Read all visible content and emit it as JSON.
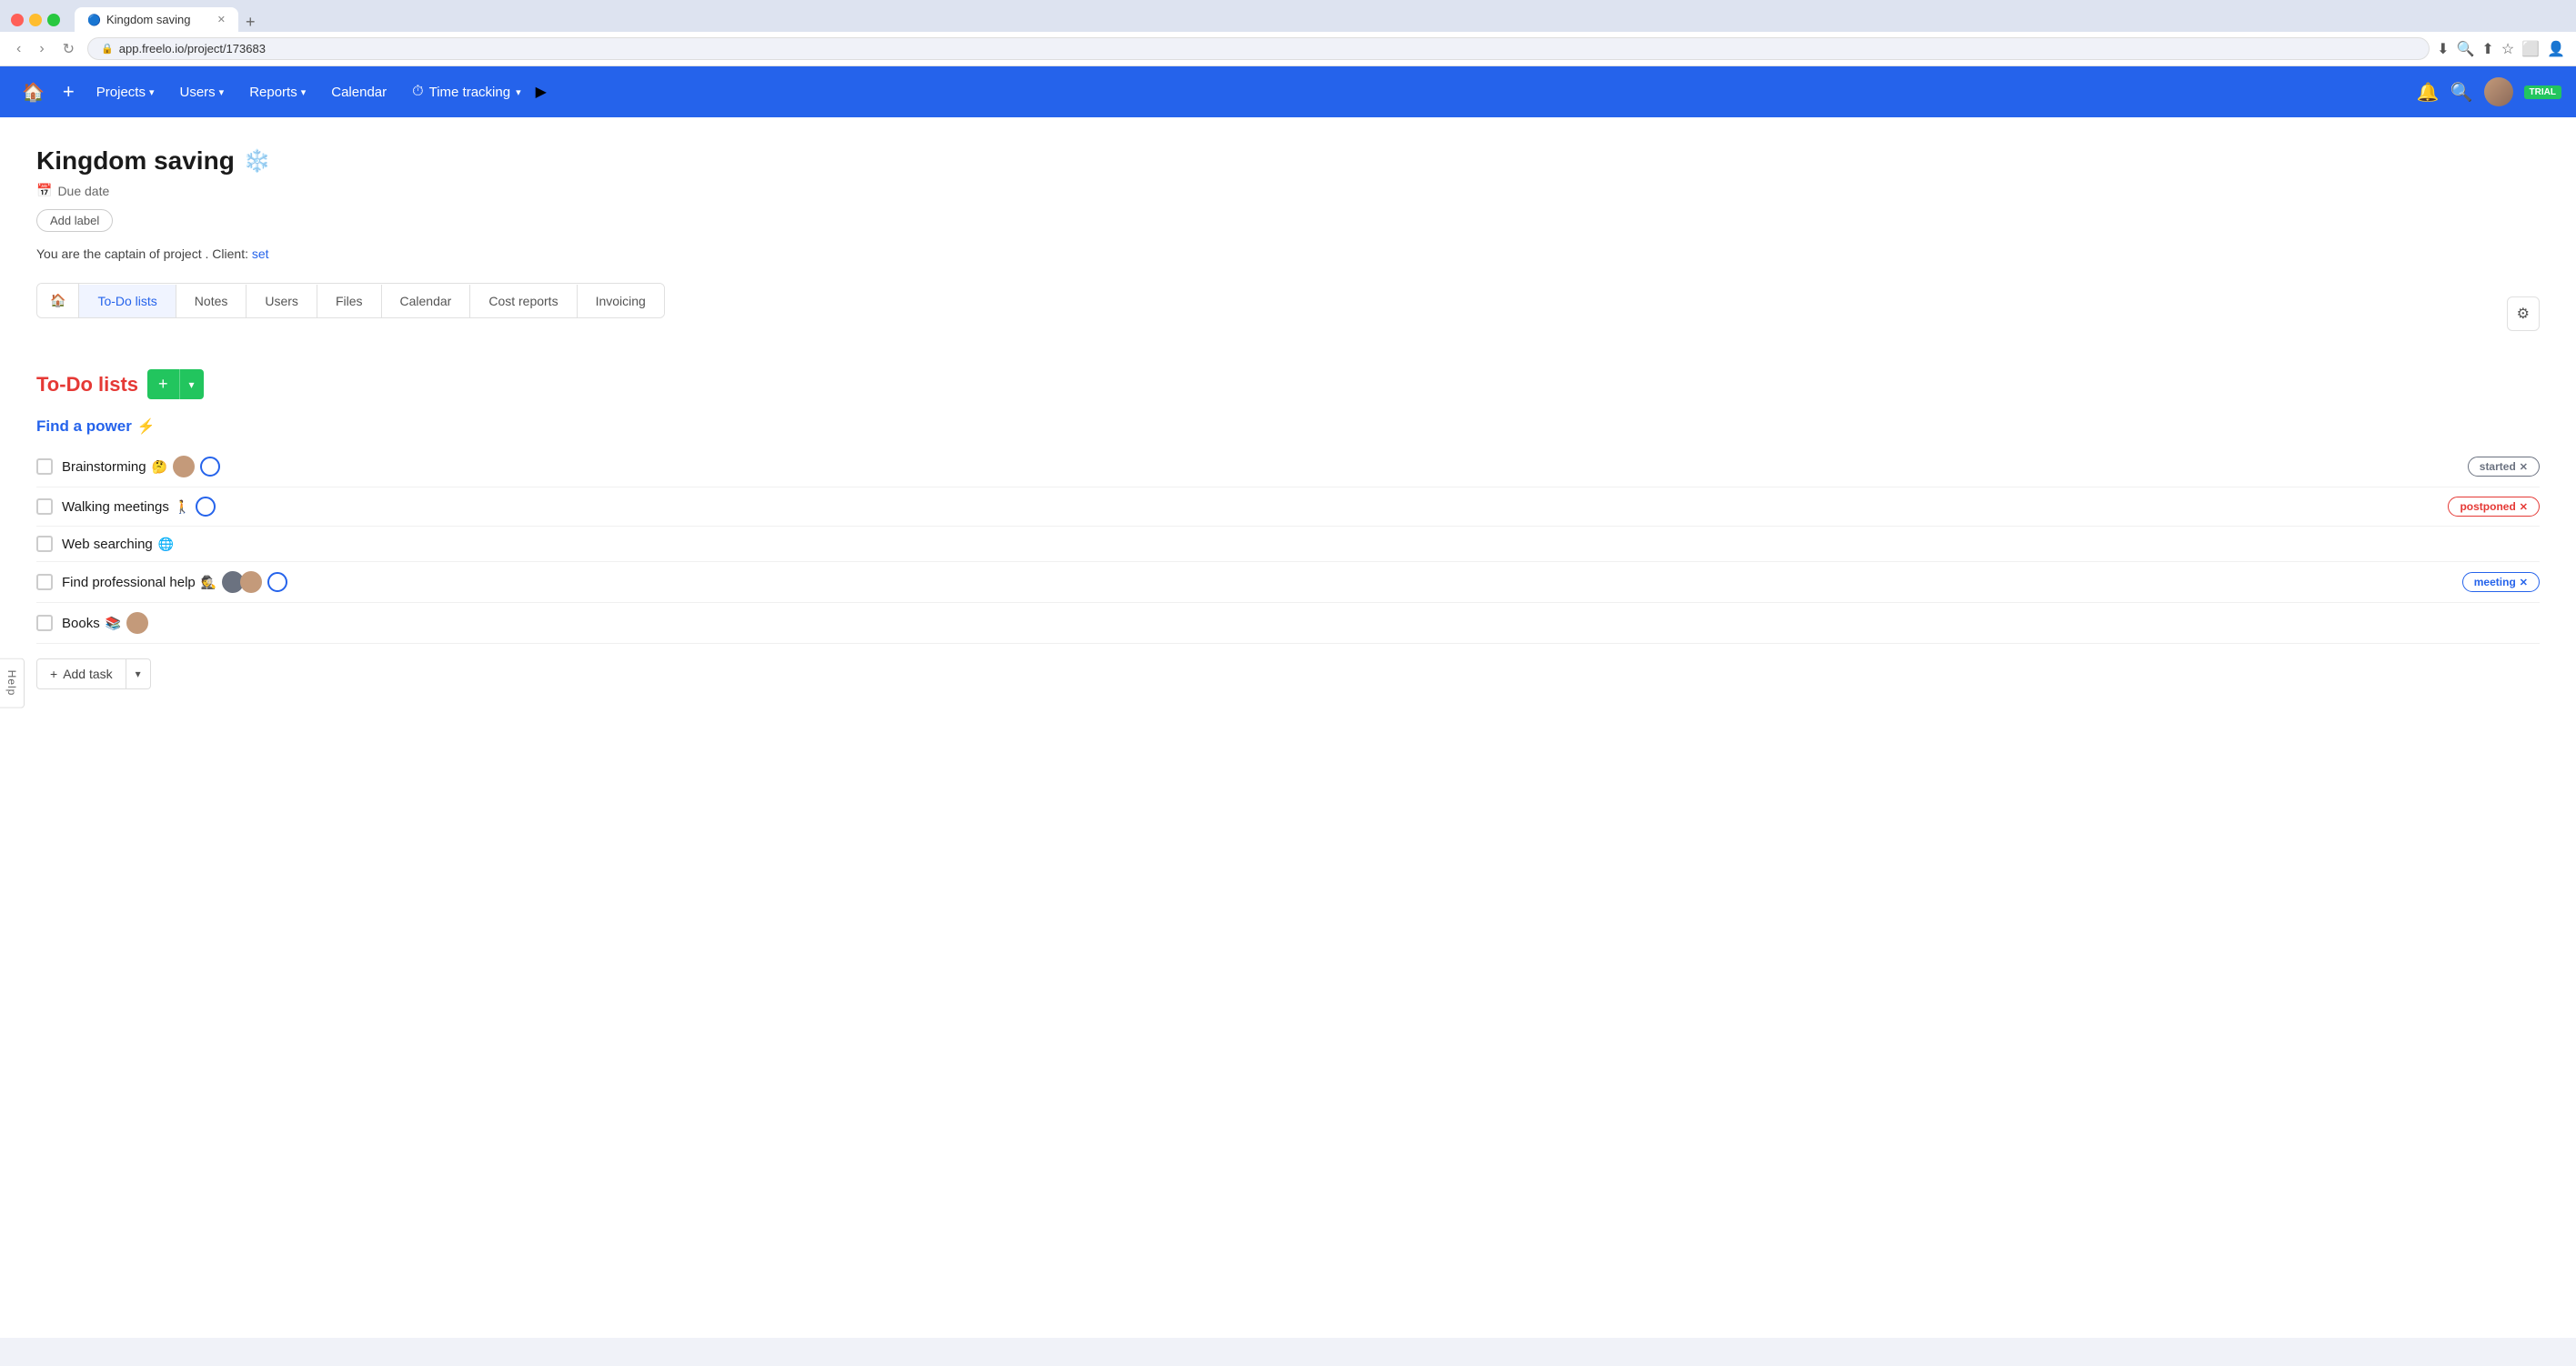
{
  "browser": {
    "tab_title": "Kingdom saving",
    "tab_url": "app.freelo.io/project/173683",
    "new_tab_label": "+"
  },
  "nav": {
    "home_icon": "🏠",
    "plus_label": "+",
    "projects_label": "Projects",
    "users_label": "Users",
    "reports_label": "Reports",
    "calendar_label": "Calendar",
    "time_tracking_label": "Time tracking",
    "play_icon": "▶",
    "trial_label": "TRIAL"
  },
  "project": {
    "title": "Kingdom saving",
    "emoji": "❄️",
    "due_date_label": "Due date",
    "add_label_btn": "Add label",
    "captain_text": "You are the captain of project",
    "client_label": "Client:",
    "client_link": "set"
  },
  "tabs": {
    "home_icon": "🏠",
    "items": [
      {
        "label": "To-Do lists",
        "active": true
      },
      {
        "label": "Notes",
        "active": false
      },
      {
        "label": "Users",
        "active": false
      },
      {
        "label": "Files",
        "active": false
      },
      {
        "label": "Calendar",
        "active": false
      },
      {
        "label": "Cost reports",
        "active": false
      },
      {
        "label": "Invoicing",
        "active": false
      }
    ],
    "settings_icon": "⚙"
  },
  "todo_section": {
    "title": "To-Do lists",
    "add_btn": "+",
    "dropdown_btn": "▾"
  },
  "find_a_power": {
    "title": "Find a power",
    "emoji": "⚡"
  },
  "tasks": [
    {
      "name": "Brainstorming",
      "emoji": "🤔",
      "has_avatar": true,
      "has_circle": true,
      "badge": "started",
      "badge_class": "badge-started"
    },
    {
      "name": "Walking meetings",
      "emoji": "🚶",
      "has_avatar": false,
      "has_circle": true,
      "badge": "postponed",
      "badge_class": "badge-postponed"
    },
    {
      "name": "Web searching",
      "emoji": "🌐",
      "has_avatar": false,
      "has_circle": false,
      "badge": "",
      "badge_class": ""
    },
    {
      "name": "Find professional help",
      "emoji": "🕵️",
      "has_avatar": true,
      "has_circle": true,
      "badge": "meeting",
      "badge_class": "badge-meeting"
    },
    {
      "name": "Books",
      "emoji": "📚",
      "has_avatar": true,
      "has_circle": false,
      "badge": "",
      "badge_class": ""
    }
  ],
  "add_task": {
    "plus_icon": "+",
    "label": "Add task",
    "dropdown_icon": "▾"
  },
  "help": {
    "label": "Help"
  }
}
